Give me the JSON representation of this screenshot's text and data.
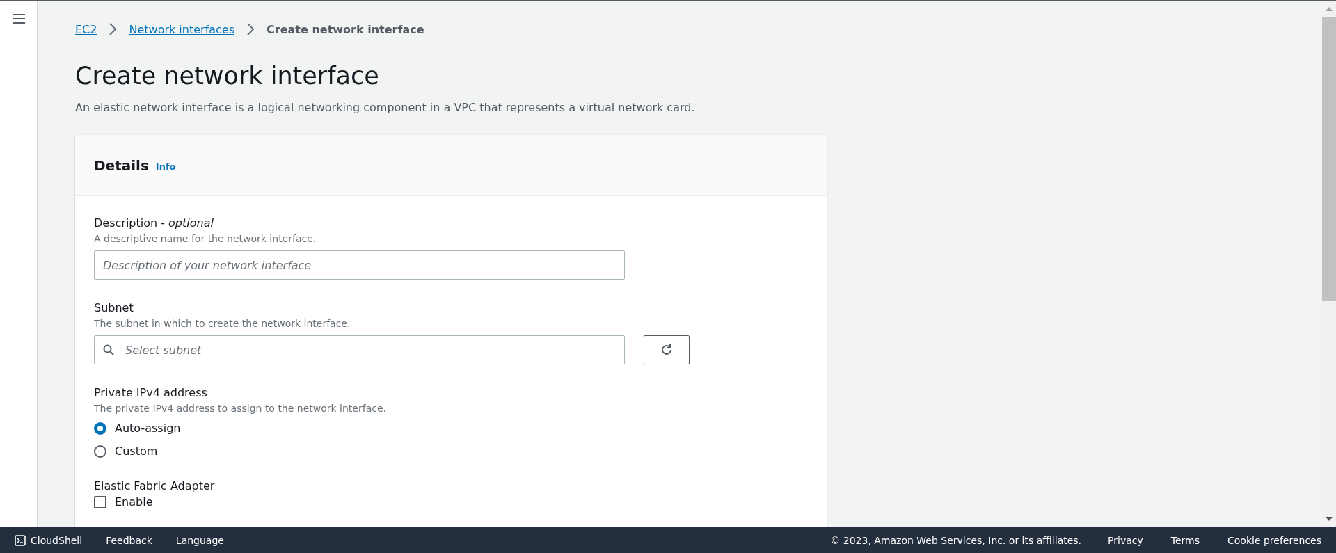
{
  "breadcrumbs": [
    {
      "label": "EC2",
      "kind": "link"
    },
    {
      "label": "Network interfaces",
      "kind": "link"
    },
    {
      "label": "Create network interface",
      "kind": "current"
    }
  ],
  "page": {
    "title": "Create network interface",
    "description": "An elastic network interface is a logical networking component in a VPC that represents a virtual network card."
  },
  "details": {
    "title": "Details",
    "info": "Info",
    "fields": [
      {
        "kind": "text",
        "label": "Description - *optional*",
        "hint": "A descriptive name for the network interface.",
        "placeholder": "Description of your network interface"
      },
      {
        "kind": "select",
        "label": "Subnet",
        "hint": "The subnet in which to create the network interface.",
        "placeholder": "Select subnet"
      },
      {
        "kind": "radio",
        "label": "Private IPv4 address",
        "hint": "The private IPv4 address to assign to the network interface.",
        "options": [
          {
            "label": "Auto-assign",
            "selected": true
          },
          {
            "label": "Custom",
            "selected": false
          }
        ]
      },
      {
        "kind": "checkbox",
        "label": "Elastic Fabric Adapter",
        "options": [
          {
            "label": "Enable",
            "checked": false
          }
        ]
      }
    ]
  },
  "footer": {
    "left": [
      "CloudShell",
      "Feedback",
      "Language"
    ],
    "copyright": "© 2023, Amazon Web Services, Inc. or its affiliates.",
    "right": [
      "Privacy",
      "Terms",
      "Cookie preferences"
    ]
  }
}
